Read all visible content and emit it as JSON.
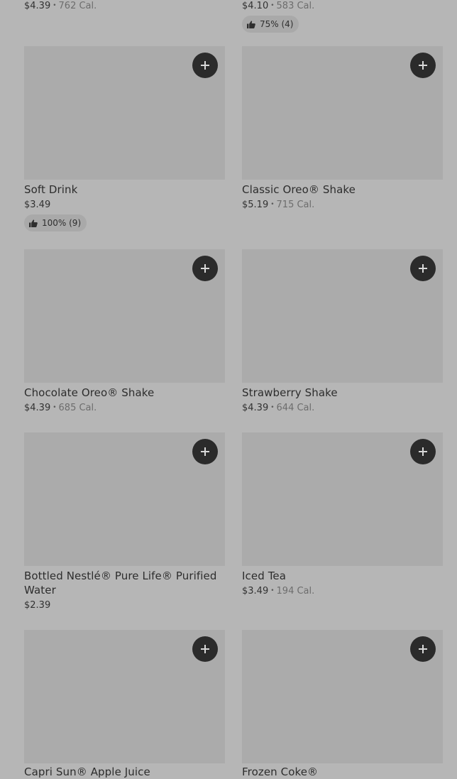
{
  "items": [
    {
      "name": "",
      "price": "$4.39",
      "cal": "762 Cal.",
      "rating": ""
    },
    {
      "name": "",
      "price": "$4.10",
      "cal": "583 Cal.",
      "rating": "75% (4)"
    },
    {
      "name": "Soft Drink",
      "price": "$3.49",
      "cal": "",
      "rating": "100% (9)"
    },
    {
      "name": "Classic Oreo® Shake",
      "price": "$5.19",
      "cal": "715 Cal.",
      "rating": ""
    },
    {
      "name": "Chocolate Oreo® Shake",
      "price": "$4.39",
      "cal": "685 Cal.",
      "rating": ""
    },
    {
      "name": "Strawberry Shake",
      "price": "$4.39",
      "cal": "644 Cal.",
      "rating": ""
    },
    {
      "name": "Bottled Nestlé® Pure Life® Purified Water",
      "price": "$2.39",
      "cal": "",
      "rating": ""
    },
    {
      "name": "Iced Tea",
      "price": "$3.49",
      "cal": "194 Cal.",
      "rating": ""
    },
    {
      "name": "Capri Sun® Apple Juice",
      "price": "",
      "cal": "",
      "rating": ""
    },
    {
      "name": "Frozen Coke®",
      "price": "",
      "cal": "",
      "rating": ""
    }
  ],
  "icons": {
    "add": "plus-icon",
    "rating": "thumbs-up-icon"
  },
  "colors": {
    "background": "#b6b6b6",
    "image_placeholder": "#ababab",
    "add_button": "#2b2b2b"
  }
}
